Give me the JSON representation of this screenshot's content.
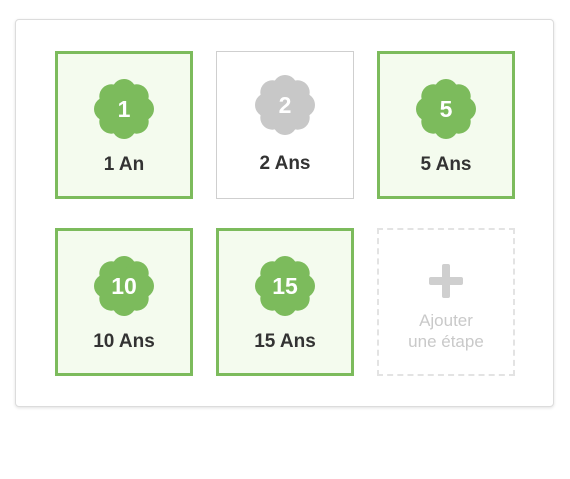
{
  "colors": {
    "active_green": "#7cbb5c",
    "inactive_gray": "#c8c8c8",
    "active_background": "#f4fbee"
  },
  "milestones": [
    {
      "number": "1",
      "label": "1 An",
      "active": true
    },
    {
      "number": "2",
      "label": "2 Ans",
      "active": false
    },
    {
      "number": "5",
      "label": "5 Ans",
      "active": true
    },
    {
      "number": "10",
      "label": "10 Ans",
      "active": true
    },
    {
      "number": "15",
      "label": "15 Ans",
      "active": true
    }
  ],
  "add_step": {
    "line1": "Ajouter",
    "line2": "une étape",
    "icon": "plus-icon"
  }
}
